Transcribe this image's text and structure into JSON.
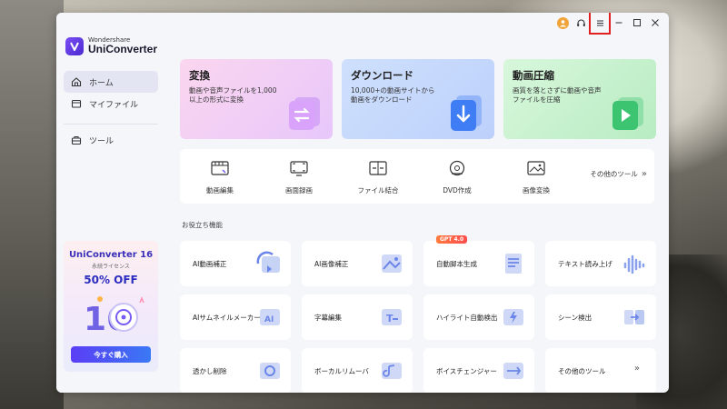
{
  "app": {
    "brand": "Wondershare",
    "product": "UniConverter"
  },
  "sidebar": {
    "items": [
      {
        "label": "ホーム",
        "icon": "home-icon"
      },
      {
        "label": "マイファイル",
        "icon": "folder-icon"
      },
      {
        "label": "ツール",
        "icon": "toolbox-icon"
      }
    ],
    "promo": {
      "title": "UniConverter 16",
      "subtitle": "永続ライセンス",
      "offer": "50% OFF",
      "button": "今すぐ購入"
    }
  },
  "features": [
    {
      "title": "変換",
      "desc": "動画や音声ファイルを1,000以上の形式に変換",
      "icon": "convert-icon"
    },
    {
      "title": "ダウンロード",
      "desc": "10,000+の動画サイトから動画をダウンロード",
      "icon": "download-icon"
    },
    {
      "title": "動画圧縮",
      "desc": "画質を落とさずに動画や音声ファイルを圧縮",
      "icon": "compress-icon"
    }
  ],
  "tools": [
    {
      "label": "動画編集",
      "icon": "video-edit-icon"
    },
    {
      "label": "画面録画",
      "icon": "screen-record-icon"
    },
    {
      "label": "ファイル結合",
      "icon": "merge-icon"
    },
    {
      "label": "DVD作成",
      "icon": "dvd-icon"
    },
    {
      "label": "画像変換",
      "icon": "image-convert-icon"
    }
  ],
  "tools_more": "その他のツール",
  "section_title": "お役立ち機能",
  "cards": [
    {
      "label": "AI動画補正",
      "icon": "ai-video-enhance-icon"
    },
    {
      "label": "AI画像補正",
      "icon": "ai-image-enhance-icon"
    },
    {
      "label": "自動脚本生成",
      "icon": "script-icon",
      "badge": "GPT 4.0"
    },
    {
      "label": "テキスト読み上げ",
      "icon": "tts-icon"
    },
    {
      "label": "AIサムネイルメーカー",
      "icon": "thumbnail-icon"
    },
    {
      "label": "字幕編集",
      "icon": "subtitle-icon"
    },
    {
      "label": "ハイライト自動検出",
      "icon": "highlight-icon"
    },
    {
      "label": "シーン検出",
      "icon": "scene-icon"
    },
    {
      "label": "透かし削除",
      "icon": "watermark-icon"
    },
    {
      "label": "ボーカルリムーバ",
      "icon": "vocal-icon"
    },
    {
      "label": "ボイスチェンジャー",
      "icon": "voice-changer-icon"
    },
    {
      "label": "その他のツール",
      "icon": "chevron-right-icon"
    }
  ],
  "colors": {
    "accent": "#5b3df5",
    "highlight": "#e02020"
  }
}
